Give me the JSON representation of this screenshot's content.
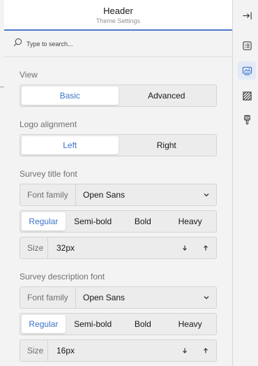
{
  "header": {
    "title": "Header",
    "subtitle": "Theme Settings"
  },
  "search": {
    "placeholder": "Type to search..."
  },
  "view": {
    "label": "View",
    "options": [
      "Basic",
      "Advanced"
    ],
    "selected": "Basic"
  },
  "logo_alignment": {
    "label": "Logo alignment",
    "options": [
      "Left",
      "Right"
    ],
    "selected": "Left"
  },
  "survey_title_font": {
    "label": "Survey title font",
    "family_label": "Font family",
    "family_value": "Open Sans",
    "weights": [
      "Regular",
      "Semi-bold",
      "Bold",
      "Heavy"
    ],
    "selected_weight": "Regular",
    "size_label": "Size",
    "size_value": "32px"
  },
  "survey_description_font": {
    "label": "Survey description font",
    "family_label": "Font family",
    "family_value": "Open Sans",
    "weights": [
      "Regular",
      "Semi-bold",
      "Bold",
      "Heavy"
    ],
    "selected_weight": "Regular",
    "size_label": "Size",
    "size_value": "16px"
  },
  "toolbar": {
    "items": [
      "collapse-panel-icon",
      "list-settings-icon",
      "theme-image-icon",
      "pattern-icon",
      "brush-icon"
    ],
    "active": "theme-image-icon"
  },
  "colors": {
    "accent": "#3b73c8",
    "header_underline": "#4a79c8",
    "panel_bg": "#f3f3f3",
    "active_tool_bg": "#e3eaf6"
  }
}
